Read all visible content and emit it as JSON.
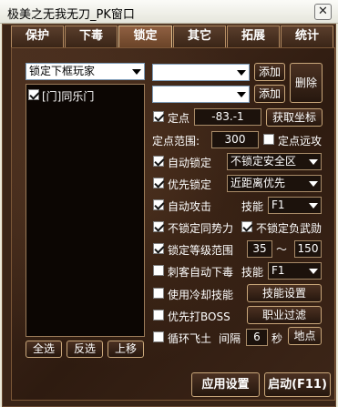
{
  "window": {
    "title": "极美之无我无刀_PK窗口",
    "close_glyph": "✕"
  },
  "tabs": [
    {
      "label": "保护"
    },
    {
      "label": "下毒"
    },
    {
      "label": "锁定"
    },
    {
      "label": "其它"
    },
    {
      "label": "拓展"
    },
    {
      "label": "统计"
    }
  ],
  "active_tab": "锁定",
  "left": {
    "target_select": "锁定下框玩家",
    "list_items": [
      {
        "label": "[门]同乐门",
        "checked": true
      }
    ],
    "buttons": {
      "select_all": "全选",
      "invert": "反选",
      "move_up": "上移"
    }
  },
  "right": {
    "combo1": "",
    "combo2": "",
    "add_label": "添加",
    "delete_label": "删除",
    "fixed_point": {
      "label": "定点",
      "value": "-83.-1",
      "checked": true,
      "get_coords_button": "获取坐标"
    },
    "range": {
      "label": "定点范围:",
      "value": "300",
      "far_attack_label": "定点远攻",
      "far_attack_checked": false
    },
    "auto_lock": {
      "label": "自动锁定",
      "checked": true,
      "option": "不锁定安全区"
    },
    "priority_lock": {
      "label": "优先锁定",
      "checked": true,
      "option": "近距离优先"
    },
    "auto_attack": {
      "label": "自动攻击",
      "checked": true,
      "skill_label": "技能",
      "skill": "F1"
    },
    "no_lock_same_force": {
      "label": "不锁定同势力",
      "checked": true
    },
    "no_lock_negative": {
      "label": "不锁定负武勋",
      "checked": true
    },
    "level_range": {
      "label": "锁定等级范围",
      "checked": true,
      "min": "35",
      "tilde": "～",
      "max": "150"
    },
    "assassin_poison": {
      "label": "刺客自动下毒",
      "checked": false,
      "skill_label": "技能",
      "skill": "F1"
    },
    "cooldown_skill": {
      "label": "使用冷却技能",
      "checked": false,
      "button": "技能设置"
    },
    "boss_first": {
      "label": "优先打BOSS",
      "checked": false,
      "button": "职业过滤"
    },
    "loop_fly": {
      "label": "循环飞土",
      "checked": false,
      "interval_label": "间隔",
      "interval": "6",
      "unit": "秒",
      "button": "地点"
    }
  },
  "footer": {
    "apply": "应用设置",
    "start": "启动(F11)"
  }
}
